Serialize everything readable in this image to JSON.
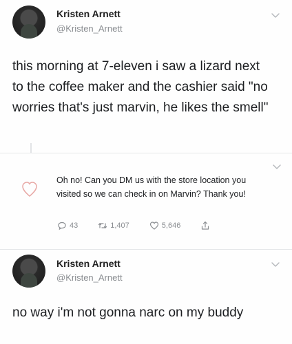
{
  "tweet1": {
    "author_name": "Kristen Arnett",
    "author_handle": "@Kristen_Arnett",
    "text": "this morning at 7-eleven i saw a lizard next to the coffee maker and the cashier said \"no worries that's just marvin, he likes the smell\""
  },
  "reply": {
    "text": "Oh no! Can you DM us with the store location you visited so we can check in on Marvin? Thank you!",
    "reply_count": "43",
    "retweet_count": "1,407",
    "like_count": "5,646"
  },
  "tweet2": {
    "author_name": "Kristen Arnett",
    "author_handle": "@Kristen_Arnett",
    "text": "no way i'm not gonna narc on my buddy"
  },
  "icons": {
    "more": "chevron-down-icon",
    "reply": "comment-icon",
    "retweet": "retweet-icon",
    "like": "heart-icon",
    "share": "share-icon",
    "brand_logo": "seven-eleven-logo-icon"
  },
  "colors": {
    "text": "#1c1e21",
    "secondary": "#8a8d91",
    "divider": "#e5e7e9"
  }
}
